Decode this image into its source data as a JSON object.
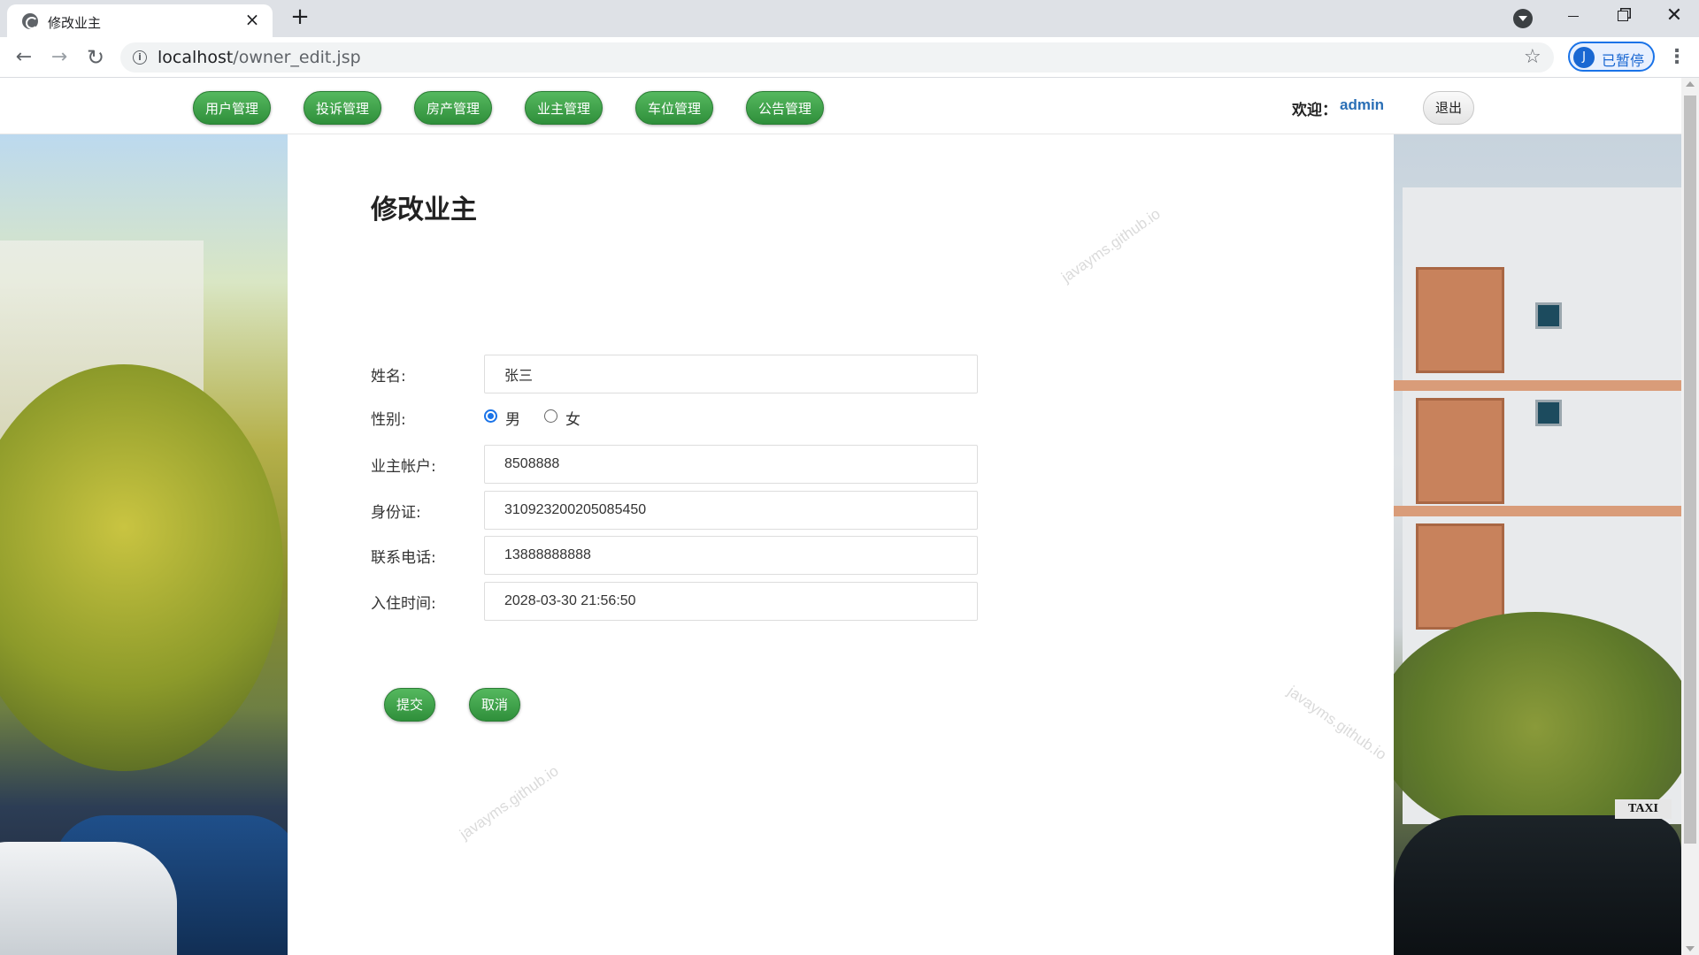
{
  "browser": {
    "tab_title": "修改业主",
    "url_host": "localhost",
    "url_path": "/owner_edit.jsp",
    "profile_initial": "J",
    "profile_label": "已暂停"
  },
  "nav": {
    "items": [
      {
        "label": "用户管理"
      },
      {
        "label": "投诉管理"
      },
      {
        "label": "房产管理"
      },
      {
        "label": "业主管理"
      },
      {
        "label": "车位管理"
      },
      {
        "label": "公告管理"
      }
    ],
    "welcome_label": "欢迎：",
    "username": "admin",
    "logout_label": "退出"
  },
  "form": {
    "title": "修改业主",
    "name_label": "姓名:",
    "name_value": "张三",
    "gender_label": "性别:",
    "gender_options": [
      {
        "label": "男",
        "checked": true
      },
      {
        "label": "女",
        "checked": false
      }
    ],
    "account_label": "业主帐户:",
    "account_value": "8508888",
    "id_label": "身份证:",
    "id_value": "310923200205085450",
    "phone_label": "联系电话:",
    "phone_value": "13888888888",
    "checkin_label": "入住时间:",
    "checkin_value": "2028-03-30 21:56:50",
    "submit_label": "提交",
    "cancel_label": "取消"
  },
  "watermark_text": "javayms.github.io",
  "colors": {
    "nav_green": "#3aa048",
    "username_blue": "#2a6fb6",
    "radio_blue": "#1a73e8"
  }
}
